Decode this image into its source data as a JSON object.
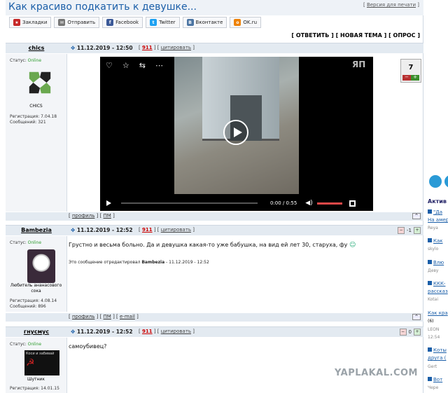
{
  "header": {
    "title": "Как красиво подкатить к девушке...",
    "print_version": "Версия для печати"
  },
  "share": [
    {
      "label": "Закладки",
      "icon": "bookmark-icon",
      "color": "#c62828"
    },
    {
      "label": "Отправить",
      "icon": "mail-icon",
      "color": "#777777"
    },
    {
      "label": "Facebook",
      "icon": "facebook-icon",
      "color": "#3b5998"
    },
    {
      "label": "Twitter",
      "icon": "twitter-icon",
      "color": "#1da1f2"
    },
    {
      "label": "Вконтакте",
      "icon": "vk-icon",
      "color": "#4c75a3"
    },
    {
      "label": "OK.ru",
      "icon": "ok-icon",
      "color": "#ee8208"
    }
  ],
  "actions": {
    "reply": "ОТВЕТИТЬ",
    "new_topic": "НОВАЯ ТЕМА",
    "poll": "ОПРОС"
  },
  "posts": [
    {
      "author": "chics",
      "date": "11.12.2019 - 12:50",
      "report": "911",
      "quote": "цитировать",
      "status_label": "Статус:",
      "status": "Online",
      "rank": "CHICS",
      "reg": "Регистрация: 7.04.18",
      "msgs": "Сообщений: 321",
      "rating": "7",
      "video": {
        "time": "0:00",
        "duration": "0:55",
        "progress": 0.0
      },
      "foot": [
        "профиль",
        "ПМ"
      ]
    },
    {
      "author": "Bambezia",
      "date": "11.12.2019 - 12:52",
      "report": "911",
      "quote": "цитировать",
      "status_label": "Статус:",
      "status": "Online",
      "rank": "Любитель ананасового сока",
      "reg": "Регистрация: 4.08.14",
      "msgs": "Сообщений: 896",
      "rating": "-1",
      "text": "Грустно и весьма больно. Да и девушка какая-то уже бабушка, на вид ей лет 30, старуха, фу",
      "edited_prefix": "Это сообщение отредактировал",
      "edited_by": "Bambezia",
      "edited_time": "- 11.12.2019 - 12:52",
      "foot": [
        "профиль",
        "ПМ",
        "e-mail"
      ]
    },
    {
      "author": "гнусмус",
      "date": "11.12.2019 - 12:52",
      "report": "911",
      "quote": "цитировать",
      "status_label": "Статус:",
      "status": "Online",
      "rank": "Шутник",
      "avatar_text": "Коси и забивай",
      "reg": "Регистрация: 14.01.15",
      "rating": "0",
      "text": "самоубивец?"
    }
  ],
  "sidebar": {
    "header": "Актив",
    "items": [
      {
        "title": "\"Да",
        "title2": "На амер",
        "user": "Reya"
      },
      {
        "title": "Как",
        "user": "skylo"
      },
      {
        "title": "Влю",
        "user": "Деву"
      },
      {
        "title": "ККК-",
        "title2": "рассказ",
        "user": "Kotai"
      },
      {
        "title": "Как кра",
        "count": "(6)",
        "user": "LEON",
        "time": "12:54"
      },
      {
        "title": "Коты",
        "title2": "друга (",
        "user": "Gert"
      },
      {
        "title": "Вот",
        "user": "Чере"
      }
    ]
  },
  "watermark": "YAPLAKAL.COM"
}
